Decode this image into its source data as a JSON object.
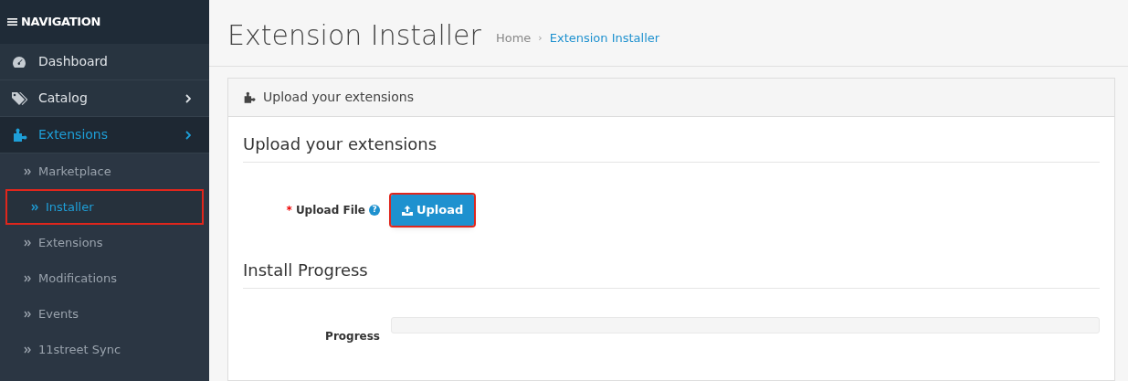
{
  "sidebar": {
    "heading": "NAVIGATION",
    "items": [
      {
        "label": "Dashboard",
        "expandable": false,
        "selected": false
      },
      {
        "label": "Catalog",
        "expandable": true,
        "selected": false
      },
      {
        "label": "Extensions",
        "expandable": true,
        "selected": true,
        "children": [
          {
            "label": "Marketplace",
            "selected": false,
            "highlighted": false
          },
          {
            "label": "Installer",
            "selected": true,
            "highlighted": true
          },
          {
            "label": "Extensions",
            "selected": false,
            "highlighted": false
          },
          {
            "label": "Modifications",
            "selected": false,
            "highlighted": false
          },
          {
            "label": "Events",
            "selected": false,
            "highlighted": false
          },
          {
            "label": "11street Sync",
            "selected": false,
            "highlighted": false
          }
        ]
      }
    ]
  },
  "page": {
    "title": "Extension Installer",
    "breadcrumbs": [
      {
        "label": "Home",
        "current": false
      },
      {
        "label": "Extension Installer",
        "current": true
      }
    ],
    "breadcrumb_separator": "›"
  },
  "panel": {
    "heading": "Upload your extensions",
    "sections": [
      {
        "title": "Upload your extensions",
        "fields": [
          {
            "kind": "upload",
            "label": "Upload File",
            "required_mark": "*",
            "help": "?",
            "button": "Upload",
            "highlighted": true
          }
        ]
      },
      {
        "title": "Install Progress",
        "fields": [
          {
            "kind": "progress",
            "label": "Progress",
            "level": 0
          }
        ]
      }
    ]
  }
}
